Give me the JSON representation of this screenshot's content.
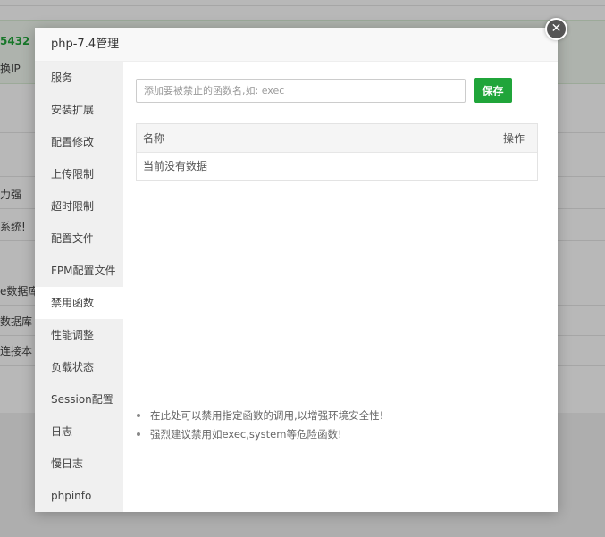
{
  "background": {
    "number_fragment": "5432",
    "ip_fragment": "换IP",
    "rows": [
      "力强",
      "系统!",
      "e数据库",
      "数据库",
      "连接本"
    ]
  },
  "modal": {
    "title": "php-7.4管理",
    "close_symbol": "✕"
  },
  "sidebar": {
    "items": [
      {
        "label": "服务"
      },
      {
        "label": "安装扩展"
      },
      {
        "label": "配置修改"
      },
      {
        "label": "上传限制"
      },
      {
        "label": "超时限制"
      },
      {
        "label": "配置文件"
      },
      {
        "label": "FPM配置文件"
      },
      {
        "label": "禁用函数"
      },
      {
        "label": "性能调整"
      },
      {
        "label": "负载状态"
      },
      {
        "label": "Session配置"
      },
      {
        "label": "日志"
      },
      {
        "label": "慢日志"
      },
      {
        "label": "phpinfo"
      }
    ],
    "active_index": 7
  },
  "content": {
    "input_placeholder": "添加要被禁止的函数名,如: exec",
    "input_value": "",
    "save_label": "保存",
    "table": {
      "col_name": "名称",
      "col_action": "操作",
      "empty_text": "当前没有数据"
    },
    "tips": [
      "在此处可以禁用指定函数的调用,以增强环境安全性!",
      "强烈建议禁用如exec,system等危险函数!"
    ]
  },
  "colors": {
    "accent": "#20a53a",
    "sidebar_bg": "#f0f0f0",
    "overlay": "rgba(0,0,0,0.28)"
  }
}
